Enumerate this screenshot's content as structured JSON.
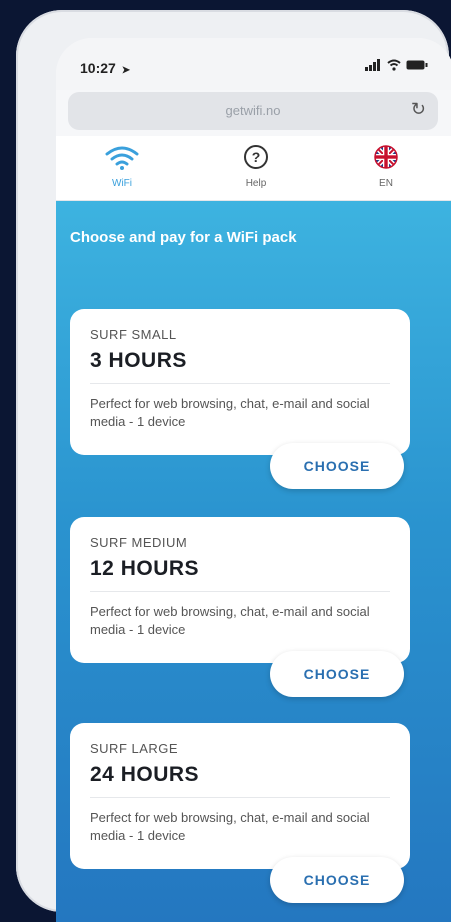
{
  "status_bar": {
    "time": "10:27",
    "location_icon": "location-arrow-icon",
    "signal_icons": "░▒ ● ▬"
  },
  "browser": {
    "url": "getwifi.no",
    "reload_icon": "reload-icon"
  },
  "nav": {
    "items": [
      {
        "label": "WiFi",
        "icon": "wifi-icon"
      },
      {
        "label": "Help",
        "icon": "help-icon"
      },
      {
        "label": "EN",
        "icon": "uk-flag-icon"
      }
    ]
  },
  "main": {
    "headline": "Choose and pay for a WiFi pack",
    "packs": [
      {
        "name": "SURF SMALL",
        "hours_number": "3",
        "hours_unit": "HOURS",
        "description": "Perfect for web browsing, chat, e-mail and social media - 1 device",
        "button_label": "CHOOSE"
      },
      {
        "name": "SURF MEDIUM",
        "hours_number": "12",
        "hours_unit": "HOURS",
        "description": "Perfect for web browsing, chat, e-mail and social media - 1 device",
        "button_label": "CHOOSE"
      },
      {
        "name": "SURF LARGE",
        "hours_number": "24",
        "hours_unit": "HOURS",
        "description": "Perfect for web browsing, chat, e-mail and social media - 1 device",
        "button_label": "CHOOSE"
      }
    ]
  },
  "colors": {
    "accent": "#3aa0dc",
    "background": "#0b1633",
    "button_text": "#2a6fb0"
  }
}
